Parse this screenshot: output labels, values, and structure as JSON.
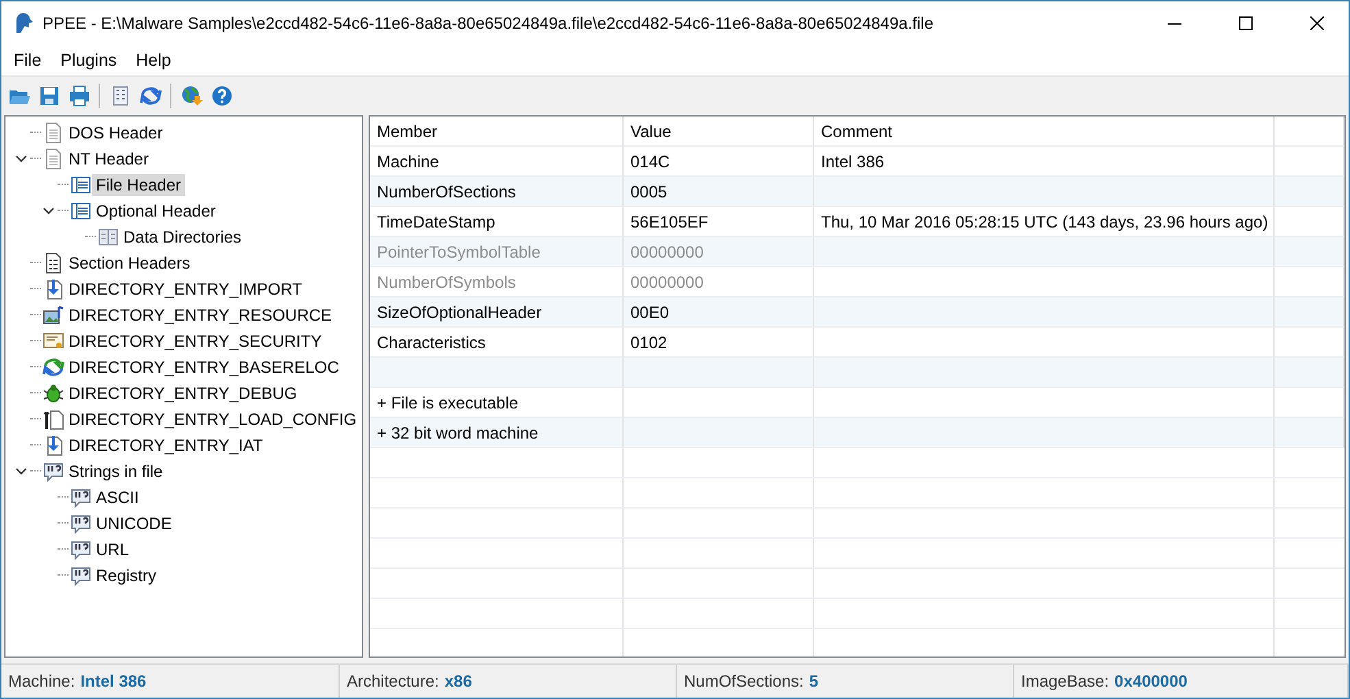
{
  "window": {
    "title": "PPEE - E:\\Malware Samples\\e2ccd482-54c6-11e6-8a8a-80e65024849a.file\\e2ccd482-54c6-11e6-8a8a-80e65024849a.file"
  },
  "menu": [
    "File",
    "Plugins",
    "Help"
  ],
  "tree": [
    {
      "label": "DOS Header",
      "selected": false
    },
    {
      "label": "NT Header",
      "selected": false,
      "expanded": true,
      "children": [
        {
          "label": "File Header",
          "selected": true
        },
        {
          "label": "Optional Header",
          "selected": false,
          "expanded": true,
          "children": [
            {
              "label": "Data Directories",
              "selected": false
            }
          ]
        }
      ]
    },
    {
      "label": "Section Headers",
      "selected": false
    },
    {
      "label": "DIRECTORY_ENTRY_IMPORT",
      "selected": false
    },
    {
      "label": "DIRECTORY_ENTRY_RESOURCE",
      "selected": false
    },
    {
      "label": "DIRECTORY_ENTRY_SECURITY",
      "selected": false
    },
    {
      "label": "DIRECTORY_ENTRY_BASERELOC",
      "selected": false
    },
    {
      "label": "DIRECTORY_ENTRY_DEBUG",
      "selected": false
    },
    {
      "label": "DIRECTORY_ENTRY_LOAD_CONFIG",
      "selected": false
    },
    {
      "label": "DIRECTORY_ENTRY_IAT",
      "selected": false
    },
    {
      "label": "Strings in file",
      "selected": false,
      "expanded": true,
      "children": [
        {
          "label": "ASCII",
          "selected": false
        },
        {
          "label": "UNICODE",
          "selected": false
        },
        {
          "label": "URL",
          "selected": false
        },
        {
          "label": "Registry",
          "selected": false
        }
      ]
    }
  ],
  "table": {
    "columns": [
      "Member",
      "Value",
      "Comment"
    ],
    "rows": [
      {
        "member": "Machine",
        "value": "014C",
        "comment": "Intel 386",
        "disabled": false
      },
      {
        "member": "NumberOfSections",
        "value": "0005",
        "disabled": false
      },
      {
        "member": "TimeDateStamp",
        "value": "56E105EF",
        "comment": "Thu, 10 Mar 2016 05:28:15 UTC (143 days, 23.96 hours ago)",
        "disabled": false
      },
      {
        "member": "PointerToSymbolTable",
        "value": "00000000",
        "disabled": true
      },
      {
        "member": "NumberOfSymbols",
        "value": "00000000",
        "disabled": true
      },
      {
        "member": "SizeOfOptionalHeader",
        "value": "00E0",
        "disabled": false
      },
      {
        "member": "Characteristics",
        "value": "0102",
        "disabled": false
      },
      {},
      {
        "member": "+ File is executable",
        "disabled": false
      },
      {
        "member": "+ 32 bit word machine",
        "disabled": false
      }
    ]
  },
  "status_bar": [
    {
      "label": "Machine:",
      "value": "Intel 386"
    },
    {
      "label": "Architecture:",
      "value": "x86"
    },
    {
      "label": "NumOfSections:",
      "value": "5"
    },
    {
      "label": "ImageBase:",
      "value": "0x400000"
    }
  ]
}
